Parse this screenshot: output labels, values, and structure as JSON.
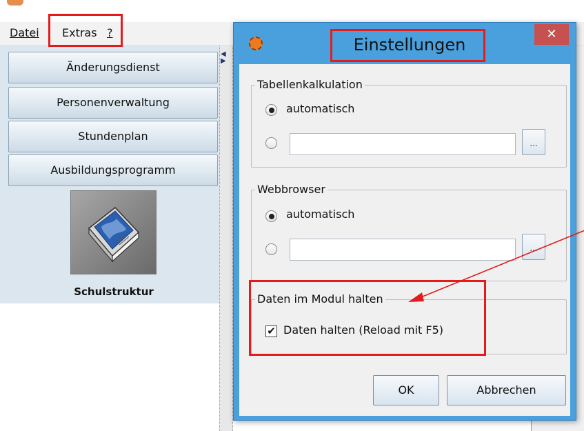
{
  "menubar": {
    "file_label": "Datei",
    "extras_label": "Extras",
    "help_label": "?"
  },
  "sidebar": {
    "items": [
      {
        "label": "Änderungsdienst"
      },
      {
        "label": "Personenverwaltung"
      },
      {
        "label": "Stundenplan"
      },
      {
        "label": "Ausbildungsprogramm"
      }
    ],
    "module_label": "Schulstruktur"
  },
  "dialog": {
    "title": "Einstellungen",
    "close_glyph": "✕",
    "spreadsheet_group": {
      "title": "Tabellenkalkulation",
      "auto_label": "automatisch",
      "auto_selected": true,
      "path_value": "",
      "browse_label": "..."
    },
    "browser_group": {
      "title": "Webbrowser",
      "auto_label": "automatisch",
      "auto_selected": true,
      "path_value": "",
      "browse_label": "..."
    },
    "data_group": {
      "title": "Daten im Modul halten",
      "checkbox_label": "Daten halten (Reload mit F5)",
      "checked": true,
      "check_glyph": "✔"
    },
    "ok_label": "OK",
    "cancel_label": "Abbrechen"
  },
  "colors": {
    "annotation": "#e51b1b",
    "dialog_frame": "#4aa0dc",
    "close_button": "#c75050",
    "sidebar_bg": "#dbe6ee"
  },
  "icons": {
    "dialog_icon": "app-logo-icon",
    "module_icon": "book-icon",
    "close": "close-icon",
    "splitter": "collapse-arrows-icon"
  }
}
